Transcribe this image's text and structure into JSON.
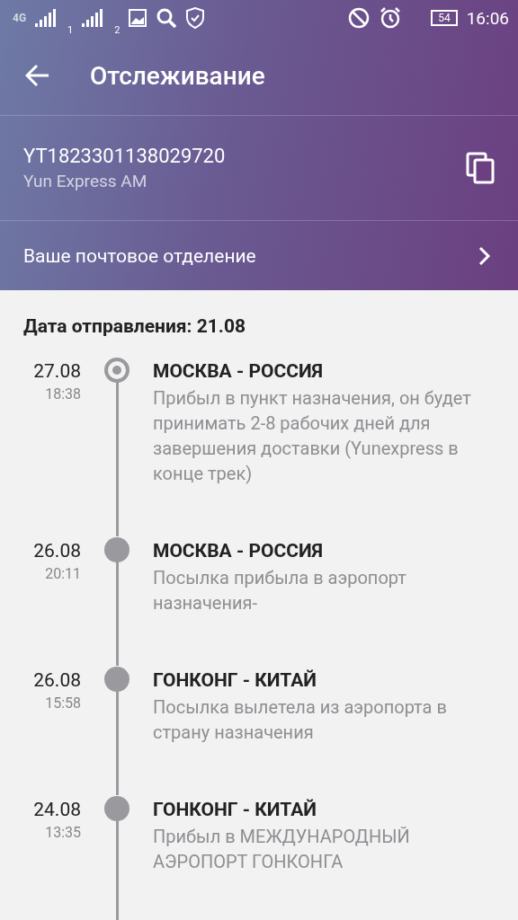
{
  "status_bar": {
    "network": "4G",
    "sim_1": "1",
    "sim_2": "2",
    "battery": "54",
    "time": "16:06"
  },
  "toolbar": {
    "title": "Отслеживание"
  },
  "parcel": {
    "tracking_number": "YT1823301138029720",
    "carrier": "Yun Express AM"
  },
  "post_office": {
    "label": "Ваше почтовое отделение"
  },
  "shipment_date": "Дата отправления: 21.08",
  "events": [
    {
      "date": "27.08",
      "time": "18:38",
      "place": "МОСКВА - РОССИЯ",
      "description": "Прибыл в пункт назначения, он будет принимать 2-8 рабочих дней для завершения доставки (Yunexpress в конце трек)",
      "current": true
    },
    {
      "date": "26.08",
      "time": "20:11",
      "place": "МОСКВА - РОССИЯ",
      "description": "Посылка прибыла в аэропорт назначения-",
      "current": false
    },
    {
      "date": "26.08",
      "time": "15:58",
      "place": "ГОНКОНГ - КИТАЙ",
      "description": "Посылка вылетела из аэропорта в страну назначения",
      "current": false
    },
    {
      "date": "24.08",
      "time": "13:35",
      "place": "ГОНКОНГ - КИТАЙ",
      "description": "Прибыл в МЕЖДУНАРОДНЫЙ АЭРОПОРТ ГОНКОНГА",
      "current": false
    }
  ]
}
